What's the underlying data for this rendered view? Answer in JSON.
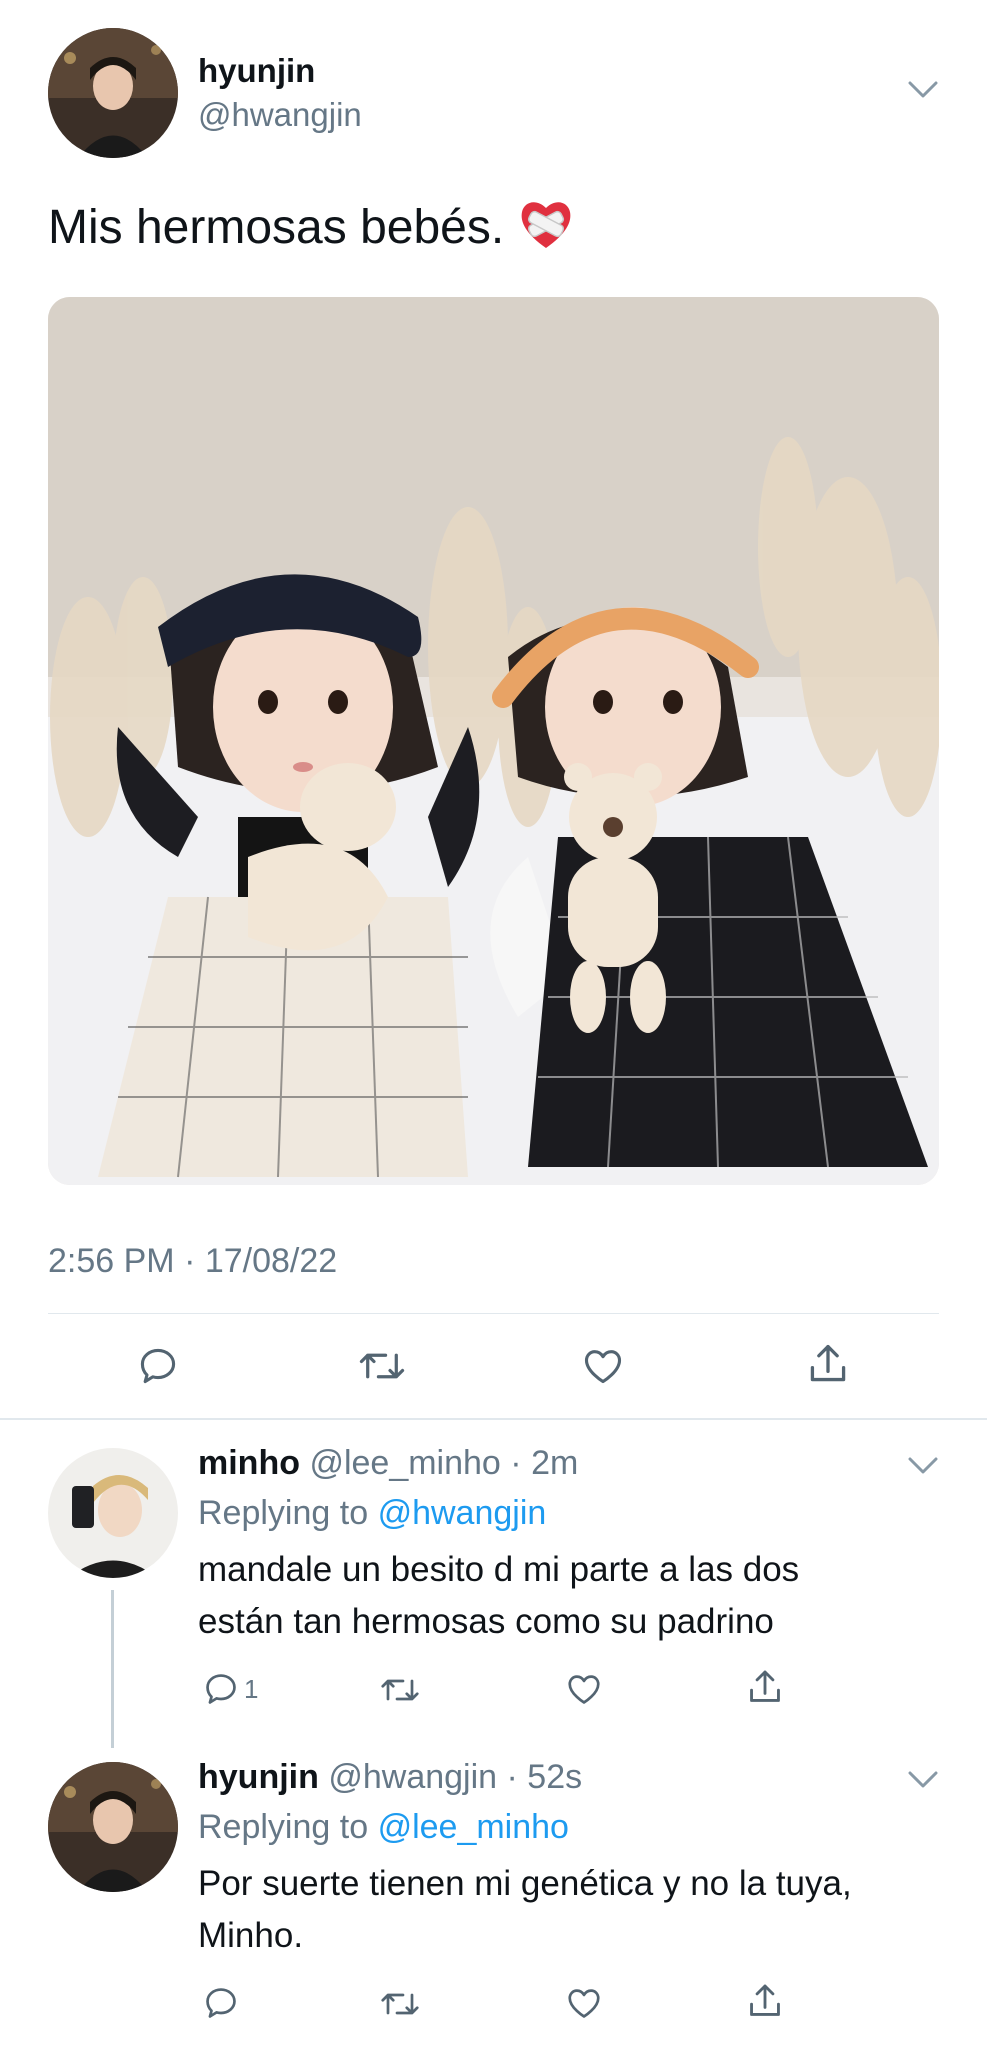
{
  "tweet": {
    "author_name": "hyunjin",
    "author_handle": "@hwangjin",
    "text": "Mis hermosas bebés.",
    "emoji": "heart-with-bandage",
    "timestamp": "2:56 PM · 17/08/22"
  },
  "replies": [
    {
      "author_name": "minho",
      "author_handle": "@lee_minho",
      "time": "· 2m",
      "replying_prefix": "Replying to",
      "replying_to": "@hwangjin",
      "text_line1": "mandale un besito d mi parte a las dos",
      "text_line2": "están tan hermosas como su padrino",
      "reply_count": "1"
    },
    {
      "author_name": "hyunjin",
      "author_handle": "@hwangjin",
      "time": "· 52s",
      "replying_prefix": "Replying to",
      "replying_to": "@lee_minho",
      "text_line1": "Por suerte tienen mi genética y no la tuya,",
      "text_line2": "Minho.",
      "reply_count": ""
    }
  ],
  "icons": [
    "chevron-down-icon",
    "reply-icon",
    "retweet-icon",
    "like-icon",
    "share-icon"
  ],
  "colors": {
    "link": "#1d9bf0",
    "secondary": "#657786",
    "divider": "#e1e8ed"
  }
}
